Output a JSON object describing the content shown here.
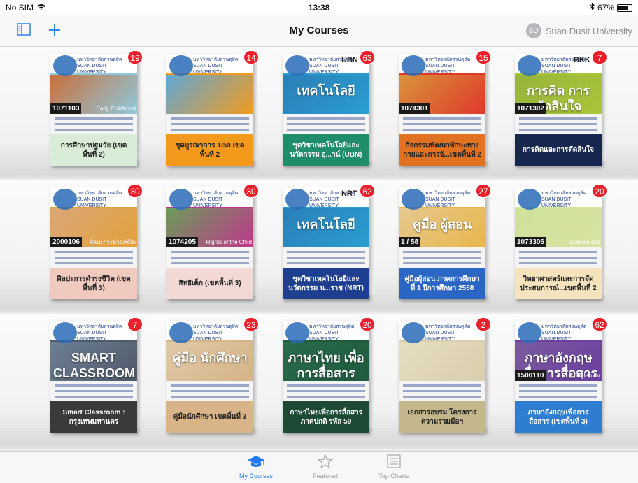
{
  "status": {
    "carrier": "No SIM",
    "time": "13:38",
    "battery": "67%",
    "battery_level": 0.67
  },
  "nav": {
    "title": "My Courses",
    "user_initials": "SU",
    "user_name": "Suan Dusit University"
  },
  "uni_line1": "มหาวิทยาลัยสวนดุสิต",
  "uni_line2": "SUAN DUSIT UNIVERSITY",
  "books": [
    {
      "title": "การศึกษาปฐมวัย (เขตพื้นที่ 2)",
      "badge": "19",
      "code": "1071103",
      "sub": "Early Childhood Education",
      "tag": "",
      "cover": "#8fc9de",
      "label_bg": "#d9ecd8",
      "label_color": "#222222",
      "art": "#c96f3a",
      "big": ""
    },
    {
      "title": "ชุดบูรณาการ 1/59 เขตพื้นที่ 2",
      "badge": "14",
      "code": "",
      "sub": "",
      "tag": "",
      "cover": "#f29b1f",
      "label_bg": "#f39a1c",
      "label_color": "#222222",
      "art": "#5fa7d6",
      "big": ""
    },
    {
      "title": "ชุดวิชาเทคโนโลยีและนวัตกรรม อุ...าน์ (UBN)",
      "badge": "63",
      "code": "",
      "sub": "",
      "tag": "UBN",
      "cover": "#2a9ed1",
      "label_bg": "#1f8d6a",
      "label_color": "#ffffff",
      "art": "#2b7fb8",
      "big": "เทคโนโลยี"
    },
    {
      "title": "กิจกรรมพัฒนาทักษะทางกายและการจั...เขตพื้นที่ 2",
      "badge": "15",
      "code": "1074301",
      "sub": "",
      "tag": "",
      "cover": "#e0392b",
      "label_bg": "#e07222",
      "label_color": "#222222",
      "art": "#d8943b",
      "big": ""
    },
    {
      "title": "การคิดและการตัดสินใจ",
      "badge": "7",
      "code": "1071302",
      "sub": "",
      "tag": "BKK",
      "cover": "#a9c63a",
      "label_bg": "#17274f",
      "label_color": "#ffffff",
      "art": "#98b43a",
      "big": "การคิด การตัดสินใจ"
    },
    {
      "title": "ศิลปะการดำรงชีวิต (เขตพื้นที่ 3)",
      "badge": "30",
      "code": "2000106",
      "sub": "ศิลปะการดำรงชีวิต",
      "tag": "",
      "cover": "#e3a13a",
      "label_bg": "#f0c9bf",
      "label_color": "#222222",
      "art": "#d9a777",
      "big": ""
    },
    {
      "title": "สิทธิเด็ก (เขตพื้นที่ 3)",
      "badge": "30",
      "code": "1074205",
      "sub": "Rights of the Child",
      "tag": "",
      "cover": "#c0378b",
      "label_bg": "#f2d9d6",
      "label_color": "#222222",
      "art": "#6b9c5a",
      "big": ""
    },
    {
      "title": "ชุดวิชาเทคโนโลยีและนวัตกรรม น...ราช (NRT)",
      "badge": "62",
      "code": "",
      "sub": "",
      "tag": "NRT",
      "cover": "#2a9ed1",
      "label_bg": "#1e3f8f",
      "label_color": "#ffffff",
      "art": "#2b7fb8",
      "big": "เทคโนโลยี"
    },
    {
      "title": "คู่มือผู้สอน ภาคการศึกษาที่ 1 ปีการศึกษา 2558",
      "badge": "27",
      "code": "1 / 58",
      "sub": "",
      "tag": "",
      "cover": "#e8b74a",
      "label_bg": "#2b66c4",
      "label_color": "#ffffff",
      "art": "#e6c890",
      "big": "คู่มือ ผู้สอน"
    },
    {
      "title": "วิทยาศาสตร์และการจัดประสบการณ์...เขตพื้นที่ 2",
      "badge": "20",
      "code": "1073306",
      "sub": "Science and Learning Experience Management",
      "tag": "",
      "cover": "#d7e3a1",
      "label_bg": "#f4e3bc",
      "label_color": "#222222",
      "art": "#cfe19a",
      "big": ""
    },
    {
      "title": "Smart Classroom : กรุงเทพมหานคร",
      "badge": "7",
      "code": "",
      "sub": "",
      "tag": "",
      "cover": "#4f5a6a",
      "label_bg": "#3a3a3a",
      "label_color": "#ffffff",
      "art": "#6d7f94",
      "big": "SMART CLASSROOM"
    },
    {
      "title": "คู่มือนักศึกษา เขตพื้นที่ 3",
      "badge": "23",
      "code": "",
      "sub": "",
      "tag": "",
      "cover": "#d5b487",
      "label_bg": "#d9b488",
      "label_color": "#222222",
      "art": "#e0c9a8",
      "big": "คู่มือ นักศึกษา"
    },
    {
      "title": "ภาษาไทยเพื่อการสื่อสาร ภาคปกติ รหัส 59",
      "badge": "20",
      "code": "",
      "sub": "",
      "tag": "",
      "cover": "#1f5a3d",
      "label_bg": "#1d4a35",
      "label_color": "#ffffff",
      "art": "#2a6b4b",
      "big": "ภาษาไทย เพื่อการสื่อสาร"
    },
    {
      "title": "เอกสารอบรม โครงการความร่วมมือฯ",
      "badge": "2",
      "code": "",
      "sub": "",
      "tag": "",
      "cover": "#d9cfae",
      "label_bg": "#c4b78c",
      "label_color": "#222222",
      "art": "#e6dcc0",
      "big": ""
    },
    {
      "title": "ภาษาอังกฤษเพื่อการสื่อสาร (เขตพื้นที่ 3)",
      "badge": "62",
      "code": "1500110",
      "sub": "English for Communication",
      "tag": "",
      "cover": "#6b3fa0",
      "label_bg": "#2f7dd0",
      "label_color": "#ffffff",
      "art": "#7a5b9e",
      "big": "ภาษาอังกฤษ เพื่อการสื่อสาร"
    }
  ],
  "tabs": [
    {
      "label": "My Courses",
      "icon": "graduation-cap-icon",
      "active": true
    },
    {
      "label": "Featured",
      "icon": "star-icon",
      "active": false
    },
    {
      "label": "Top Charts",
      "icon": "list-icon",
      "active": false
    }
  ]
}
